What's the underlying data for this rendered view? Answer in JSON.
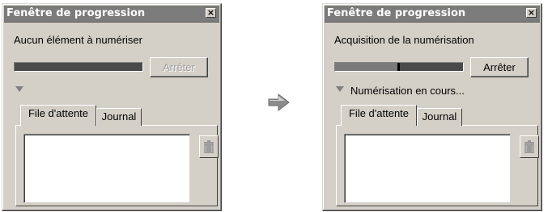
{
  "left_window": {
    "title": "Fenêtre de progression",
    "close_glyph": "×",
    "status": "Aucun élément à numériser",
    "progress_fraction": 0,
    "stop_label": "Arrêter",
    "stop_enabled": false,
    "expander_label": "",
    "tabs": [
      {
        "label": "File d'attente",
        "active": true
      },
      {
        "label": "Journal",
        "active": false
      }
    ],
    "trash_icon": "trash-icon"
  },
  "transition_icon": "right-arrow-icon",
  "right_window": {
    "title": "Fenêtre de progression",
    "close_glyph": "×",
    "status": "Acquisition de la numérisation",
    "progress_fraction": 0.5,
    "stop_label": "Arrêter",
    "stop_enabled": true,
    "expander_label": "Numérisation en cours...",
    "tabs": [
      {
        "label": "File d'attente",
        "active": true
      },
      {
        "label": "Journal",
        "active": false
      }
    ],
    "trash_icon": "trash-icon"
  },
  "colors": {
    "window_bg": "#d4d0c8",
    "titlebar_bg": "#7b7b7b",
    "progress_track": "#4a4a4a",
    "progress_fill": "#7a7a7a"
  }
}
